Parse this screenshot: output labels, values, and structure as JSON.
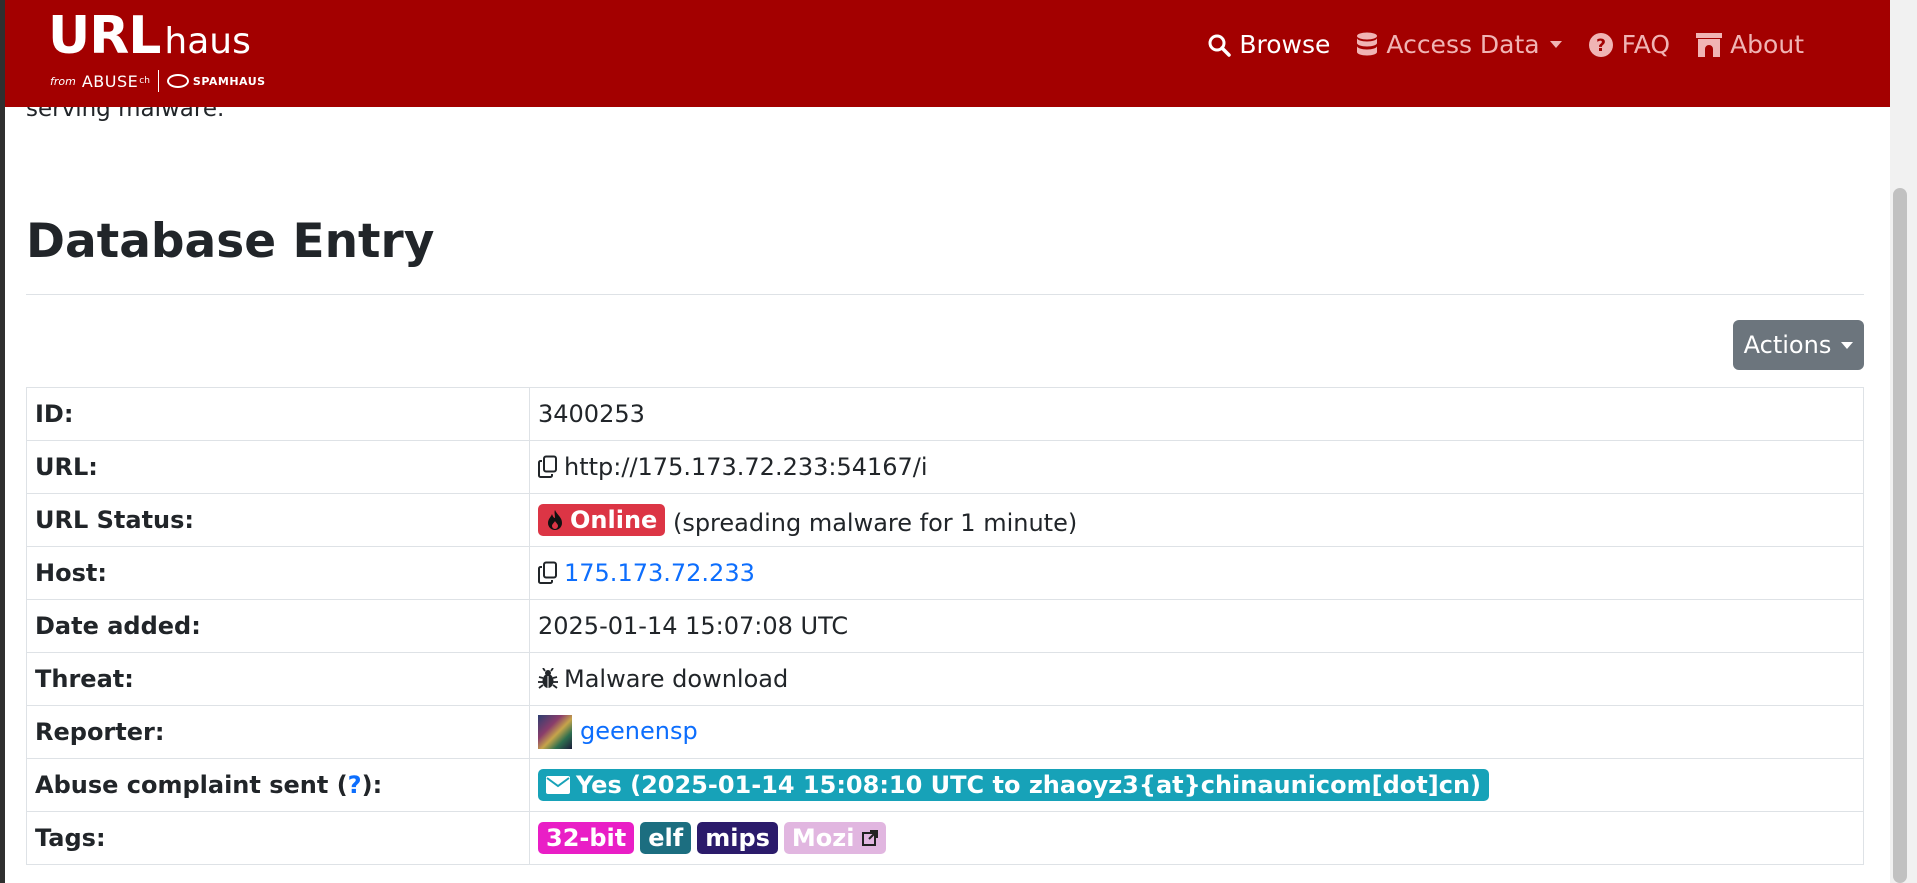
{
  "brand": {
    "logo_main": "URL",
    "logo_sub": "haus",
    "from_text": "from",
    "abuse_text": "ABUSE",
    "abuse_ch": "ch",
    "spamhaus_text": "SPAMHAUS"
  },
  "nav": {
    "browse": "Browse",
    "access_data": "Access Data",
    "faq": "FAQ",
    "about": "About"
  },
  "intro_text": "serving malware.",
  "page_title": "Database Entry",
  "actions_label": "Actions",
  "entry": {
    "id_label": "ID:",
    "id_value": "3400253",
    "url_label": "URL:",
    "url_value": "http://175.173.72.233:54167/i",
    "status_label": "URL Status:",
    "status_badge": "Online",
    "status_note": "(spreading malware for 1 minute)",
    "host_label": "Host:",
    "host_value": "175.173.72.233",
    "date_label": "Date added:",
    "date_value": "2025-01-14 15:07:08 UTC",
    "threat_label": "Threat:",
    "threat_value": "Malware download",
    "reporter_label": "Reporter:",
    "reporter_value": "geenensp",
    "abuse_label_pre": "Abuse complaint sent (",
    "abuse_label_q": "?",
    "abuse_label_post": "):",
    "abuse_value": "Yes (2025-01-14 15:08:10 UTC to zhaoyz3{at}chinaunicom[dot]cn)",
    "tags_label": "Tags:",
    "tags": [
      {
        "label": "32-bit",
        "color": "#e91ec6"
      },
      {
        "label": "elf",
        "color": "#1c6e80"
      },
      {
        "label": "mips",
        "color": "#2b1b6b"
      },
      {
        "label": "Mozi",
        "color": "#e1b6e0"
      }
    ]
  },
  "colors": {
    "navbar": "#a30000",
    "online": "#dc3545",
    "abuse": "#17a2b8",
    "link": "#0d6efd",
    "actions": "#6c757d"
  }
}
